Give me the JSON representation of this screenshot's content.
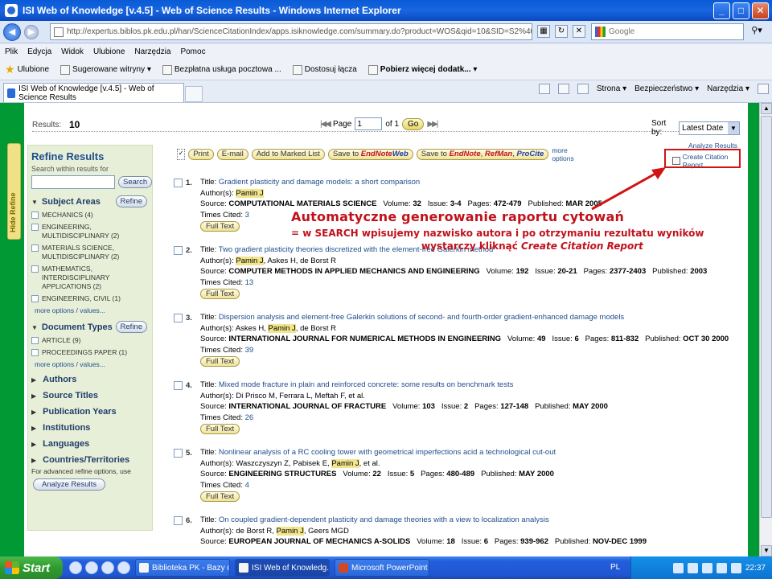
{
  "window": {
    "title": "ISI Web of Knowledge [v.4.5] - Web of Science Results - Windows Internet Explorer",
    "url": "http://expertus.biblos.pk.edu.pl/han/ScienceCitationIndex/apps.isiknowledge.com/summary.do?product=WOS&qid=10&SID=S2%40G9EG4C%40podH9j4Ba8s",
    "search_placeholder": "Google",
    "tab_label": "ISI Web of Knowledge [v.4.5] - Web of Science Results"
  },
  "menu": [
    "Plik",
    "Edycja",
    "Widok",
    "Ulubione",
    "Narzędzia",
    "Pomoc"
  ],
  "favorites": {
    "label": "Ulubione",
    "items": [
      "Sugerowane witryny ▾",
      "Bezpłatna usługa pocztowa ...",
      "Dostosuj łącza",
      "Pobierz więcej dodatk... ▾"
    ]
  },
  "command_bar": [
    "Strona ▾",
    "Bezpieczeństwo ▾",
    "Narzędzia ▾"
  ],
  "results_bar": {
    "results_label": "Results:",
    "results_count": "10",
    "page_label": "Page",
    "page_value": "1",
    "of_label": "of 1",
    "go_label": "Go",
    "sort_label": "Sort by:",
    "sort_value": "Latest Date"
  },
  "sidebar": {
    "hide_label": "Hide Refine",
    "title": "Refine Results",
    "search_hint": "Search within results for",
    "search_button": "Search",
    "refine_button": "Refine",
    "subject_areas": {
      "title": "Subject Areas",
      "items": [
        "MECHANICS (4)",
        "ENGINEERING, MULTIDISCIPLINARY (2)",
        "MATERIALS SCIENCE, MULTIDISCIPLINARY (2)",
        "MATHEMATICS, INTERDISCIPLINARY APPLICATIONS (2)",
        "ENGINEERING, CIVIL (1)"
      ],
      "more": "more options / values..."
    },
    "document_types": {
      "title": "Document Types",
      "items": [
        "ARTICLE (9)",
        "PROCEEDINGS PAPER (1)"
      ],
      "more": "more options / values..."
    },
    "collapsed": [
      "Authors",
      "Source Titles",
      "Publication Years",
      "Institutions",
      "Languages",
      "Countries/Territories"
    ],
    "note": "For advanced refine options, use",
    "analyze_button": "Analyze Results"
  },
  "toolbar": {
    "print": "Print",
    "email": "E-mail",
    "marked": "Add to Marked List",
    "save_prefix": "Save to ",
    "endnote_web_a": "EndNote",
    "endnote_web_b": "Web",
    "save2_prefix": "Save to ",
    "endnote": "EndNote",
    "refman": "RefMan",
    "procite": "ProCite",
    "sep": ", ",
    "more": "more options",
    "analyze_link": "Analyze Results",
    "citation_link": "Create Citation Report"
  },
  "labels": {
    "title": "Title: ",
    "authors": "Author(s): ",
    "source": "Source: ",
    "volume": "Volume: ",
    "issue": "Issue: ",
    "pages": "Pages: ",
    "published": "Published: ",
    "times_cited": "Times Cited: ",
    "full_text": "Full Text"
  },
  "records": [
    {
      "num": "1.",
      "title": "Gradient plasticity and damage models: a short comparison",
      "authors_before": "",
      "authors_hl": "Pamin J",
      "authors_after": "",
      "source": "COMPUTATIONAL MATERIALS SCIENCE",
      "volume": "32",
      "issue": "3-4",
      "pages": "472-479",
      "published": "MAR 2005",
      "cited": "3"
    },
    {
      "num": "2.",
      "title": "Two gradient plasticity theories discretized with the element-free Galerkin method",
      "authors_before": "",
      "authors_hl": "Pamin J",
      "authors_after": ", Askes H, de Borst R",
      "source": "COMPUTER METHODS IN APPLIED MECHANICS AND ENGINEERING",
      "volume": "192",
      "issue": "20-21",
      "pages": "2377-2403",
      "published": "2003",
      "cited": "13"
    },
    {
      "num": "3.",
      "title": "Dispersion analysis and element-free Galerkin solutions of second- and fourth-order gradient-enhanced damage models",
      "authors_before": "Askes H, ",
      "authors_hl": "Pamin J",
      "authors_after": ", de Borst R",
      "source": "INTERNATIONAL JOURNAL FOR NUMERICAL METHODS IN ENGINEERING",
      "volume": "49",
      "issue": "6",
      "pages": "811-832",
      "published": "OCT 30 2000",
      "cited": "39"
    },
    {
      "num": "4.",
      "title": "Mixed mode fracture in plain and reinforced concrete: some results on benchmark tests",
      "authors_before": "Di Prisco M, Ferrara L, Meftah F, et al.",
      "authors_hl": "",
      "authors_after": "",
      "source": "INTERNATIONAL JOURNAL OF FRACTURE",
      "volume": "103",
      "issue": "2",
      "pages": "127-148",
      "published": "MAY 2000",
      "cited": "26"
    },
    {
      "num": "5.",
      "title": "Nonlinear analysis of a RC cooling tower with geometrical imperfections acid a technological cut-out",
      "authors_before": "Waszczyszyn Z, Pabisek E, ",
      "authors_hl": "Pamin J",
      "authors_after": ", et al.",
      "source": "ENGINEERING STRUCTURES",
      "volume": "22",
      "issue": "5",
      "pages": "480-489",
      "published": "MAY 2000",
      "cited": "4"
    },
    {
      "num": "6.",
      "title": "On coupled gradient-dependent plasticity and damage theories with a view to localization analysis",
      "authors_before": "de Borst R, ",
      "authors_hl": "Pamin J",
      "authors_after": ", Geers MGD",
      "source": "EUROPEAN JOURNAL OF MECHANICS A-SOLIDS",
      "volume": "18",
      "issue": "6",
      "pages": "939-962",
      "published": "NOV-DEC 1999",
      "cited": ""
    }
  ],
  "annotation": {
    "line1": "Automatyczne generowanie raportu cytowań",
    "line2a": "= w SEARCH wpisujemy nazwisko autora i po otrzymaniu rezultatu wyników",
    "line2b": "wystarczy kliknąć ",
    "line2c": "Create Citation Report"
  },
  "taskbar": {
    "start": "Start",
    "tasks": [
      "Biblioteka PK - Bazy o...",
      "ISI Web of Knowledg...",
      "Microsoft PowerPoint ..."
    ],
    "lang": "PL",
    "clock": "22:37"
  },
  "colors": {
    "accent_red": "#d01313",
    "green_frame": "#009933",
    "link_blue": "#1f4e8c",
    "highlight": "#f2e58e"
  }
}
